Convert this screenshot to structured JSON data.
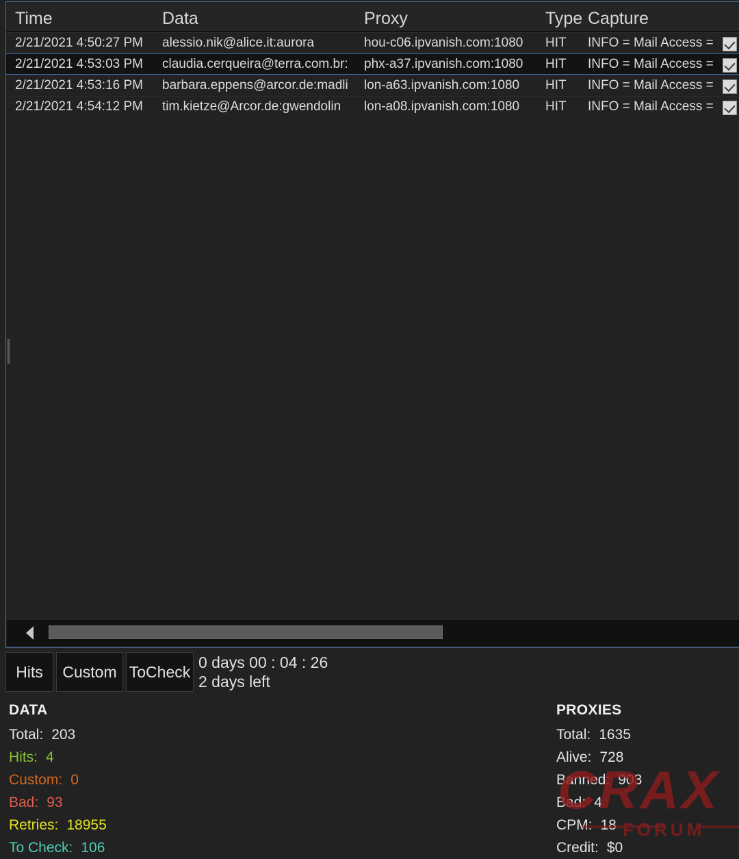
{
  "grid": {
    "columns": [
      {
        "key": "time",
        "label": "Time"
      },
      {
        "key": "data",
        "label": "Data"
      },
      {
        "key": "proxy",
        "label": "Proxy"
      },
      {
        "key": "type",
        "label": "Type"
      },
      {
        "key": "capture",
        "label": "Capture"
      }
    ],
    "rows": [
      {
        "time": "2/21/2021 4:50:27 PM",
        "data": "alessio.nik@alice.it:aurora",
        "proxy": "hou-c06.ipvanish.com:1080",
        "type": "HIT",
        "capture": "INFO = Mail Access =",
        "selected": false
      },
      {
        "time": "2/21/2021 4:53:03 PM",
        "data": "claudia.cerqueira@terra.com.br:",
        "proxy": "phx-a37.ipvanish.com:1080",
        "type": "HIT",
        "capture": "INFO = Mail Access =",
        "selected": true
      },
      {
        "time": "2/21/2021 4:53:16 PM",
        "data": "barbara.eppens@arcor.de:madli",
        "proxy": "lon-a63.ipvanish.com:1080",
        "type": "HIT",
        "capture": "INFO = Mail Access =",
        "selected": false
      },
      {
        "time": "2/21/2021 4:54:12 PM",
        "data": "tim.kietze@Arcor.de:gwendolin",
        "proxy": "lon-a08.ipvanish.com:1080",
        "type": "HIT",
        "capture": "INFO = Mail Access =",
        "selected": false
      }
    ]
  },
  "scrollbar": {
    "left_arrow_icon": "triangle-left-icon"
  },
  "tabs": [
    {
      "label": "Hits"
    },
    {
      "label": "Custom"
    },
    {
      "label": "ToCheck"
    }
  ],
  "timer": {
    "elapsed": "0  days  00 : 04 : 26",
    "remaining": "2 days left"
  },
  "stats": {
    "data": {
      "title": "DATA",
      "rows": [
        {
          "label": "Total:",
          "value": "203",
          "color": "#e4e4e4"
        },
        {
          "label": "Hits:",
          "value": "4",
          "color": "#86c232"
        },
        {
          "label": "Custom:",
          "value": "0",
          "color": "#d2691e"
        },
        {
          "label": "Bad:",
          "value": "93",
          "color": "#e05d4a"
        },
        {
          "label": "Retries:",
          "value": "18955",
          "color": "#e3e321"
        },
        {
          "label": "To Check:",
          "value": "106",
          "color": "#4ecdb4"
        }
      ]
    },
    "proxies": {
      "title": "PROXIES",
      "rows": [
        {
          "label": "Total:",
          "value": "1635",
          "color": "#e4e4e4"
        },
        {
          "label": "Alive:",
          "value": "728",
          "color": "#e4e4e4"
        },
        {
          "label": "Banned:",
          "value": "903",
          "color": "#e4e4e4"
        },
        {
          "label": "Bad:",
          "value": "4",
          "color": "#e4e4e4"
        },
        {
          "label": "CPM:",
          "value": "18",
          "color": "#e4e4e4"
        },
        {
          "label": "Credit:",
          "value": "$0",
          "color": "#e4e4e4"
        }
      ]
    }
  },
  "watermark": {
    "brand": "CRAX",
    "sub": "FORUM",
    "color": "#8c1c1c"
  },
  "colors": {
    "background": "#222222",
    "panel_border": "#4a6f9c",
    "selected_row_border": "#3f6ea8",
    "selected_row_bg": "#131313"
  }
}
